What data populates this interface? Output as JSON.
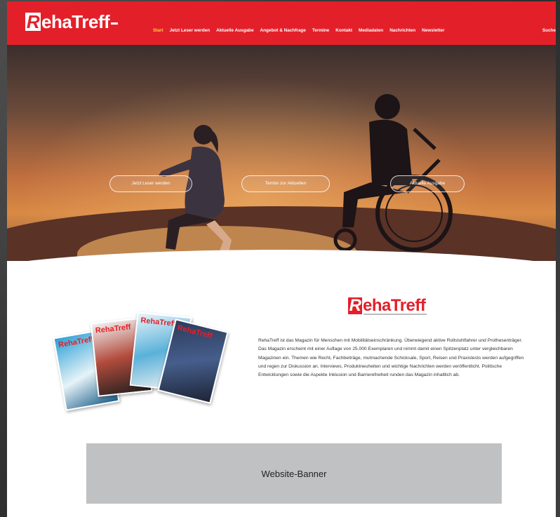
{
  "nav": {
    "logo": {
      "r": "R",
      "text": "ehaTreff"
    },
    "items": [
      {
        "label": "Start"
      },
      {
        "label": "Jetzt Leser werden"
      },
      {
        "label": "Aktuelle Ausgabe"
      },
      {
        "label": "Angebot & Nachfrage"
      },
      {
        "label": "Termine"
      },
      {
        "label": "Kontakt"
      },
      {
        "label": "Mediadaten"
      },
      {
        "label": "Nachrichten"
      },
      {
        "label": "Newsletter"
      }
    ],
    "search_label": "Suche"
  },
  "hero": {
    "buttons": [
      {
        "label": "Jetzt Leser werden"
      },
      {
        "label": "Termin zur Aktuellen"
      },
      {
        "label": "Aktuelle Ausgabe"
      }
    ]
  },
  "intro": {
    "brand": {
      "r": "R",
      "text": "ehaTreff"
    },
    "magazines": [
      {
        "label": "RehaTreff"
      },
      {
        "label": "RehaTreff"
      },
      {
        "label": "RehaTreff"
      },
      {
        "label": "RehaTreff"
      }
    ],
    "description": "RehaTreff ist das Magazin für Menschen mit Mobilitätseinschränkung. Überwiegend aktive Rollstuhlfahrer und Prothesenträger. Das Magazin erscheint mit einer Auflage von 25.000 Exemplaren und nimmt damit einen Spitzenplatz unter vergleichbaren Magazinen ein. Themen wie Recht, Fachbeiträge, mutmachende Schicksale, Sport, Reisen und Praxistests werden aufgegriffen und regen zur Diskussion an. Interviews, Produktneuheiten und wichtige Nachrichten werden veröffentlicht. Politische Entwicklungen sowie die Aspekte Inklusion und Barrierefreiheit runden das Magazin inhaltlich ab."
  },
  "banner": {
    "label": "Website-Banner"
  },
  "colors": {
    "brand_red": "#e3202a",
    "active_nav": "#ffd34a",
    "banner_bg": "#c0c1c3"
  }
}
